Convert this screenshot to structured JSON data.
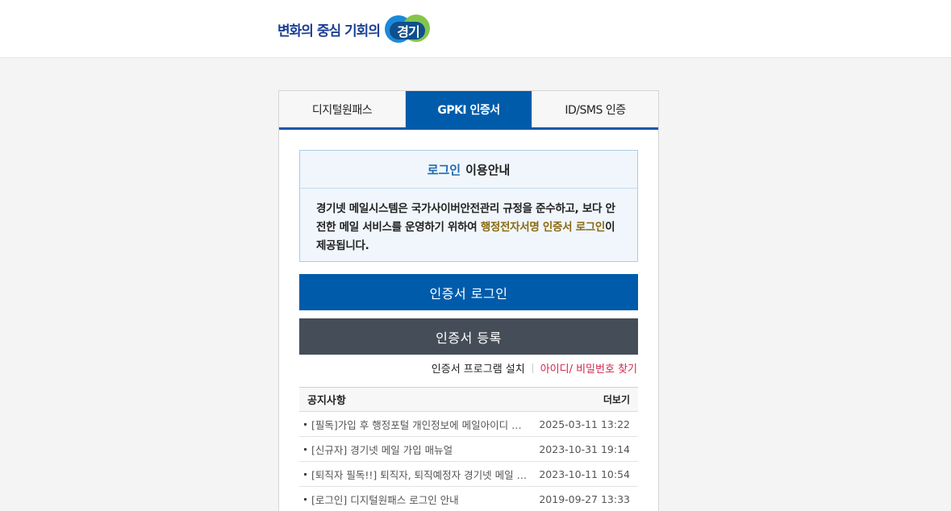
{
  "header": {
    "logo_text": "변화의 중심 기회의",
    "logo_badge": "경기"
  },
  "tabs": [
    {
      "label": "디지털원패스",
      "active": false
    },
    {
      "label": "GPKI 인증서",
      "active": true
    },
    {
      "label": "ID/SMS 인증",
      "active": false
    }
  ],
  "guide": {
    "title_accent": "로그인",
    "title_rest": "이용안내",
    "body_1": "경기넷 메일시스템은 국가사이버안전관리 규정을 준수하고, 보다 안전한 메일 서비스를 운영하기 위하여 ",
    "body_highlight": "행정전자서명 인증서 로그인",
    "body_2": "이 제공됩니다."
  },
  "buttons": {
    "login": "인증서 로그인",
    "register": "인증서 등록"
  },
  "links": {
    "install": "인증서 프로그램 설치",
    "find": "아이디/ 비밀번호 찾기"
  },
  "notice": {
    "heading": "공지사항",
    "more": "더보기",
    "items": [
      {
        "title": "[필독]가입 후 행정포털 개인정보에 메일아이디 입력 안내",
        "date": "2025-03-11 13:22"
      },
      {
        "title": "[신규자] 경기넷 메일 가입 매뉴얼",
        "date": "2023-10-31 19:14"
      },
      {
        "title": "[퇴직자 필독!!] 퇴직자, 퇴직예정자 경기넷 메일 안내",
        "date": "2023-10-11 10:54"
      },
      {
        "title": "[로그인] 디지털원패스 로그인 안내",
        "date": "2019-09-27 13:33"
      }
    ]
  },
  "colors": {
    "primary": "#005bab",
    "dark_button": "#454e58",
    "link_red": "#d0254b",
    "highlight": "#8a6a10"
  }
}
